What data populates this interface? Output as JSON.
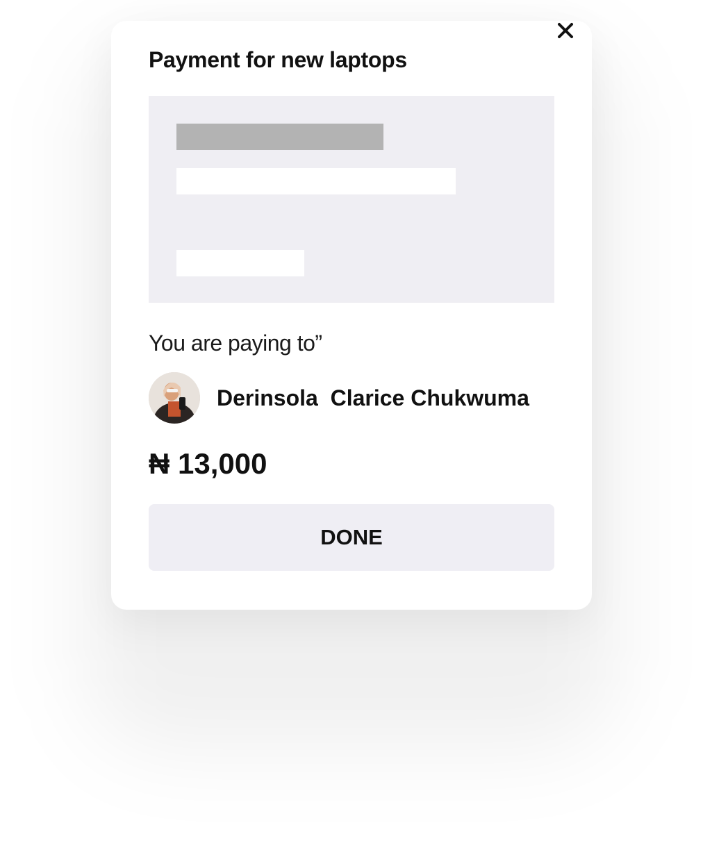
{
  "dialog": {
    "title": "Payment for new laptops",
    "close_icon": "close-icon"
  },
  "payee": {
    "label": "You are paying to”",
    "name": "Derinsola  Clarice Chukwuma",
    "avatar_icon": "avatar-photo"
  },
  "payment": {
    "amount": "₦ 13,000"
  },
  "actions": {
    "done_label": "DONE"
  },
  "colors": {
    "placeholder_bg": "#efeef3",
    "placeholder_dark": "#b3b3b3",
    "button_bg": "#efeef4",
    "text": "#111111"
  }
}
